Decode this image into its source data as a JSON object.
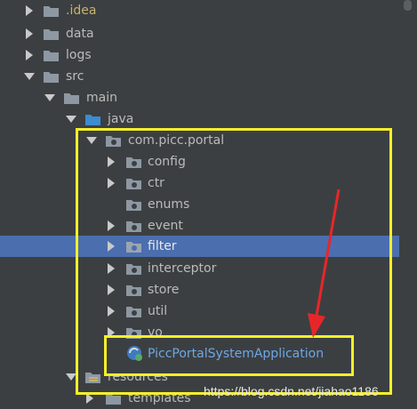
{
  "tree": {
    "items": [
      {
        "label": ".idea",
        "type": "folder",
        "expanded": false
      },
      {
        "label": "data",
        "type": "folder",
        "expanded": false
      },
      {
        "label": "logs",
        "type": "folder",
        "expanded": false
      },
      {
        "label": "src",
        "type": "folder",
        "expanded": true
      },
      {
        "label": "main",
        "type": "folder",
        "expanded": true
      },
      {
        "label": "java",
        "type": "source-folder",
        "expanded": true
      },
      {
        "label": "com.picc.portal",
        "type": "package",
        "expanded": true
      },
      {
        "label": "config",
        "type": "package",
        "expanded": false
      },
      {
        "label": "ctr",
        "type": "package",
        "expanded": false
      },
      {
        "label": "enums",
        "type": "package",
        "expanded": false
      },
      {
        "label": "event",
        "type": "package",
        "expanded": false
      },
      {
        "label": "filter",
        "type": "package",
        "expanded": false,
        "selected": true
      },
      {
        "label": "interceptor",
        "type": "package",
        "expanded": false
      },
      {
        "label": "store",
        "type": "package",
        "expanded": false
      },
      {
        "label": "util",
        "type": "package",
        "expanded": false
      },
      {
        "label": "vo",
        "type": "package",
        "expanded": false
      },
      {
        "label": "PiccPortalSystemApplication",
        "type": "spring-boot-class"
      },
      {
        "label": "resources",
        "type": "resources-folder",
        "expanded": true
      },
      {
        "label": "templates",
        "type": "folder",
        "expanded": false
      }
    ]
  },
  "watermark": "https://blog.csdn.net/jiahao1186",
  "colors": {
    "background": "#3c3f41",
    "selection": "#4b6eaf",
    "highlight": "#f5f029",
    "arrow": "#e8262a"
  }
}
